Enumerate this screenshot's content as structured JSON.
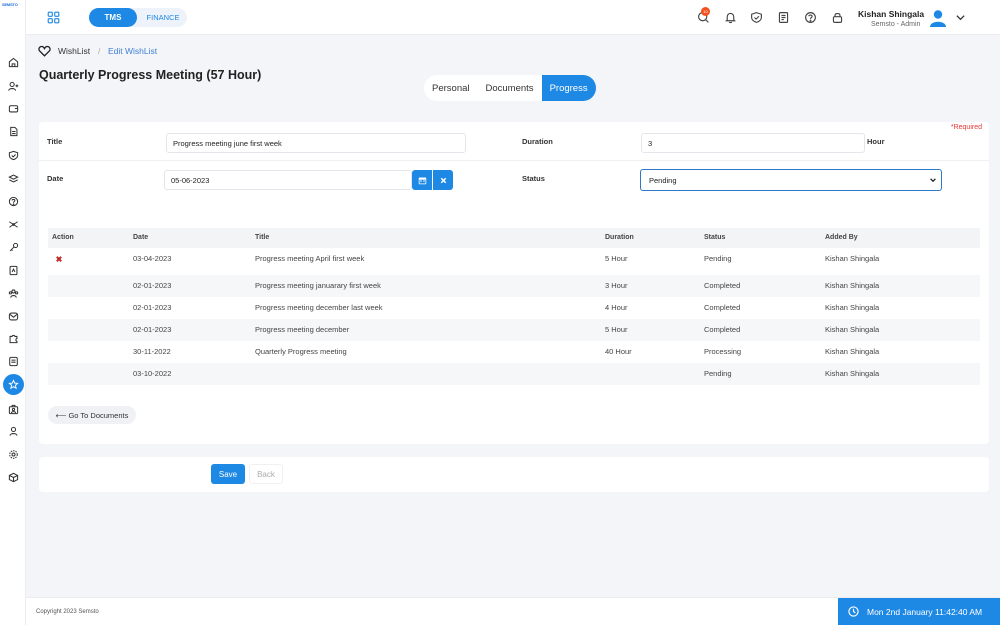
{
  "app": {
    "logo_text": "SEMSTO"
  },
  "header": {
    "module_tms": "TMS",
    "module_finance": "FINANCE",
    "notification_count": "10",
    "user_name": "Kishan Shingala",
    "user_role": "Semsto - Admin"
  },
  "breadcrumb": {
    "root": "WishList",
    "separator": "/",
    "current": "Edit WishList"
  },
  "page": {
    "title": "Quarterly Progress Meeting (57 Hour)"
  },
  "tabs": [
    {
      "label": "Personal"
    },
    {
      "label": "Documents"
    },
    {
      "label": "Progress"
    }
  ],
  "form": {
    "required_note": "*Required",
    "title_label": "Title",
    "title_value": "Progress meeting june first week",
    "duration_label": "Duration",
    "duration_value": "3",
    "duration_unit": "Hour",
    "date_label": "Date",
    "date_value": "05-06-2023",
    "status_label": "Status",
    "status_value": "Pending"
  },
  "table": {
    "headers": {
      "action": "Action",
      "date": "Date",
      "title": "Title",
      "duration": "Duration",
      "status": "Status",
      "added_by": "Added By"
    },
    "rows": [
      {
        "date": "03-04-2023",
        "title": "Progress meeting April first week",
        "duration": "5 Hour",
        "status": "Pending",
        "added_by": "Kishan Shingala"
      },
      {
        "date": "02-01-2023",
        "title": "Progress meeting januarary first week",
        "duration": "3 Hour",
        "status": "Completed",
        "added_by": "Kishan Shingala"
      },
      {
        "date": "02-01-2023",
        "title": "Progress meeting december last week",
        "duration": "4 Hour",
        "status": "Completed",
        "added_by": "Kishan Shingala"
      },
      {
        "date": "02-01-2023",
        "title": "Progress meeting december",
        "duration": "5 Hour",
        "status": "Completed",
        "added_by": "Kishan Shingala"
      },
      {
        "date": "30-11-2022",
        "title": "Quarterly Progress meeting",
        "duration": "40 Hour",
        "status": "Processing",
        "added_by": "Kishan Shingala"
      },
      {
        "date": "03-10-2022",
        "title": "",
        "duration": "",
        "status": "Pending",
        "added_by": "Kishan Shingala"
      }
    ]
  },
  "buttons": {
    "goto_documents": "⟵ Go To Documents",
    "save": "Save",
    "back": "Back"
  },
  "footer": {
    "copyright": "Copyright 2023 Semsto",
    "clock": "Mon 2nd January 11:42:40 AM"
  },
  "colors": {
    "accent": "#1e88e5",
    "required": "#e53935",
    "delete": "#c62828"
  }
}
